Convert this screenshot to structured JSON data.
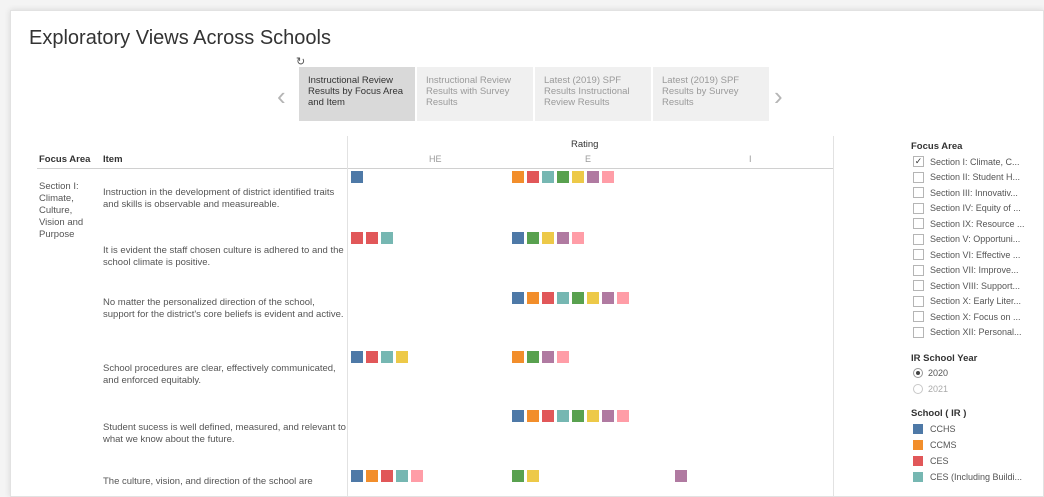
{
  "page": {
    "title": "Exploratory Views Across Schools"
  },
  "nav": {
    "refresh_icon": "↻",
    "prev_icon": "‹",
    "next_icon": "›",
    "tabs": [
      {
        "label": "Instructional Review Results by Focus Area and Item",
        "active": true
      },
      {
        "label": "Instructional Review Results with Survey Results",
        "active": false
      },
      {
        "label": "Latest (2019) SPF Results Instructional Review Results",
        "active": false
      },
      {
        "label": "Latest (2019) SPF Results by Survey Results",
        "active": false
      }
    ]
  },
  "table": {
    "focus_area_header": "Focus Area",
    "item_header": "Item",
    "rating_header": "Rating",
    "rating_columns": [
      "HE",
      "E",
      "I"
    ],
    "focus_area_value": "Section I: Climate, Culture, Vision and Purpose",
    "items": [
      "Instruction in the development of district identified traits and skills is observable and measureable.",
      "It is evident the staff chosen culture is adhered to and the school climate is positive.",
      "No matter the personalized direction of the school, support for the district's core beliefs is evident and active.",
      "School procedures are clear, effectively communicated, and enforced equitably.",
      "Student sucess is well defined, measured, and relevant to what we know about the future.",
      "The culture, vision, and direction of the school are"
    ]
  },
  "colors": {
    "blue": "#4e79a7",
    "orange": "#f28e2b",
    "red": "#e15759",
    "teal": "#76b7b2",
    "green": "#59a14f",
    "yellow": "#edc948",
    "purple": "#b07aa1",
    "pink": "#ff9da7"
  },
  "chart_data": {
    "type": "table",
    "columns": [
      "HE",
      "E",
      "I"
    ],
    "rows": [
      {
        "HE": [
          "blue"
        ],
        "E": [
          "orange",
          "red",
          "teal",
          "green",
          "yellow",
          "purple",
          "pink"
        ],
        "I": []
      },
      {
        "HE": [
          "red",
          "red",
          "teal"
        ],
        "E": [
          "blue",
          "green",
          "yellow",
          "purple",
          "pink"
        ],
        "I": []
      },
      {
        "HE": [],
        "E": [
          "blue",
          "orange",
          "red",
          "teal",
          "green",
          "yellow",
          "purple",
          "pink"
        ],
        "I": []
      },
      {
        "HE": [
          "blue",
          "red",
          "teal",
          "yellow"
        ],
        "E": [
          "orange",
          "green",
          "purple",
          "pink"
        ],
        "I": []
      },
      {
        "HE": [],
        "E": [
          "blue",
          "orange",
          "red",
          "teal",
          "green",
          "yellow",
          "purple",
          "pink"
        ],
        "I": []
      },
      {
        "HE": [
          "blue",
          "orange",
          "red",
          "teal",
          "pink"
        ],
        "E": [
          "green",
          "yellow"
        ],
        "I": [
          "purple"
        ]
      }
    ]
  },
  "filters": {
    "focus_area": {
      "title": "Focus Area",
      "checked_mark": "✓",
      "items": [
        {
          "label": "Section I: Climate, C...",
          "checked": true
        },
        {
          "label": "Section II: Student H...",
          "checked": false
        },
        {
          "label": "Section III: Innovativ...",
          "checked": false
        },
        {
          "label": "Section IV: Equity of ...",
          "checked": false
        },
        {
          "label": "Section IX: Resource ...",
          "checked": false
        },
        {
          "label": "Section V: Opportuni...",
          "checked": false
        },
        {
          "label": "Section VI: Effective ...",
          "checked": false
        },
        {
          "label": "Section VII: Improve...",
          "checked": false
        },
        {
          "label": "Section VIII: Support...",
          "checked": false
        },
        {
          "label": "Section X: Early Liter...",
          "checked": false
        },
        {
          "label": "Section X: Focus on ...",
          "checked": false
        },
        {
          "label": "Section XII: Personal...",
          "checked": false
        }
      ]
    },
    "ir_school_year": {
      "title": "IR School Year",
      "options": [
        {
          "label": "2020",
          "selected": true
        },
        {
          "label": "2021",
          "selected": false
        }
      ]
    },
    "school": {
      "title": "School ( IR )",
      "items": [
        {
          "label": "CCHS",
          "color": "#4e79a7"
        },
        {
          "label": "CCMS",
          "color": "#f28e2b"
        },
        {
          "label": "CES",
          "color": "#e15759"
        },
        {
          "label": "CES (Including Buildi...",
          "color": "#76b7b2"
        }
      ]
    }
  }
}
